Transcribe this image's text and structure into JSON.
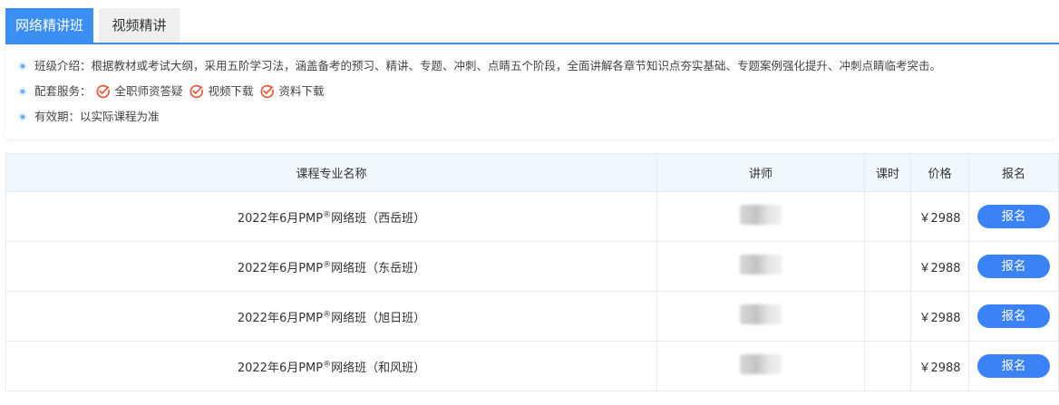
{
  "tabs": [
    {
      "label": "网络精讲班",
      "active": true
    },
    {
      "label": "视频精讲",
      "active": false
    }
  ],
  "info": {
    "intro": "班级介绍：根据教材或考试大纲，采用五阶学习法，涵盖备考的预习、精讲、专题、冲刺、点睛五个阶段，全面讲解各章节知识点夯实基础、专题案例强化提升、冲刺点睛临考突击。",
    "services_label": "配套服务：",
    "services": [
      "全职师资答疑",
      "视频下载",
      "资料下载"
    ],
    "validity": "有效期：以实际课程为准"
  },
  "table": {
    "headers": [
      "课程专业名称",
      "讲师",
      "课时",
      "价格",
      "报名"
    ],
    "rows": [
      {
        "name_prefix": "2022年6月PMP",
        "name_mark": "®",
        "name_suffix": "网络班（西岳班）",
        "hours": "",
        "price": "￥2988",
        "action": "报名"
      },
      {
        "name_prefix": "2022年6月PMP",
        "name_mark": "®",
        "name_suffix": "网络班（东岳班）",
        "hours": "",
        "price": "￥2988",
        "action": "报名"
      },
      {
        "name_prefix": "2022年6月PMP",
        "name_mark": "®",
        "name_suffix": "网络班（旭日班）",
        "hours": "",
        "price": "￥2988",
        "action": "报名"
      },
      {
        "name_prefix": "2022年6月PMP",
        "name_mark": "®",
        "name_suffix": "网络班（和风班）",
        "hours": "",
        "price": "￥2988",
        "action": "报名"
      }
    ]
  },
  "colors": {
    "accent": "#3b8ff2",
    "button": "#3b82f6",
    "check": "#e8563a",
    "header_bg": "#f1f7fe"
  }
}
